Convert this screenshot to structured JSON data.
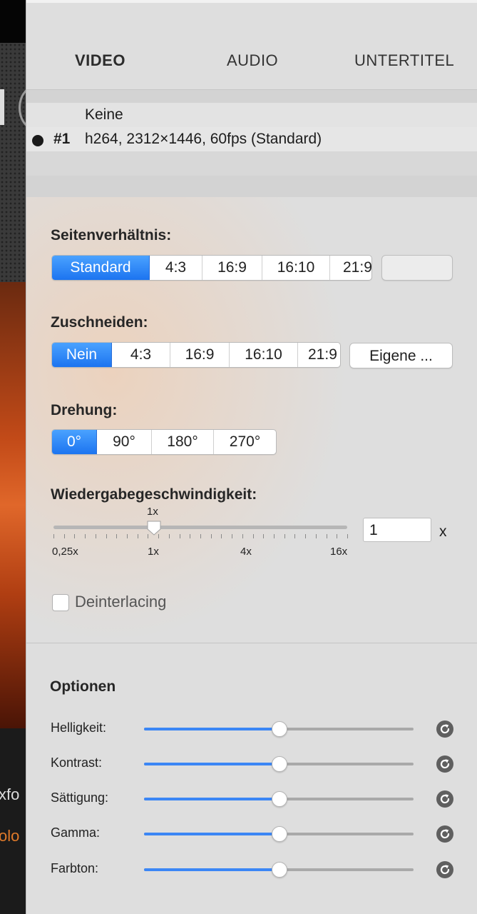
{
  "tabs": [
    "VIDEO",
    "AUDIO",
    "UNTERTITEL"
  ],
  "tracks": [
    {
      "num": "",
      "label": "Keine",
      "selected": false
    },
    {
      "num": "#1",
      "label": "h264, 2312×1446, 60fps (Standard)",
      "selected": true
    }
  ],
  "aspect": {
    "label": "Seitenverhältnis:",
    "options": [
      "Standard",
      "4:3",
      "16:9",
      "16:10",
      "21:9"
    ],
    "selected": "Standard",
    "custom_value": ""
  },
  "crop": {
    "label": "Zuschneiden:",
    "options": [
      "Nein",
      "4:3",
      "16:9",
      "16:10",
      "21:9"
    ],
    "selected": "Nein",
    "custom_button": "Eigene ..."
  },
  "rotation": {
    "label": "Drehung:",
    "options": [
      "0°",
      "90°",
      "180°",
      "270°"
    ],
    "selected": "0°"
  },
  "speed": {
    "label": "Wiedergabegeschwindigkeit:",
    "current_label": "1x",
    "tick_labels": [
      "0,25x",
      "1x",
      "4x",
      "16x"
    ],
    "value": "1",
    "unit": "x"
  },
  "deinterlacing": {
    "label": "Deinterlacing",
    "checked": false
  },
  "options": {
    "title": "Optionen",
    "sliders": [
      {
        "label": "Helligkeit:",
        "value": 0.5
      },
      {
        "label": "Kontrast:",
        "value": 0.5
      },
      {
        "label": "Sättigung:",
        "value": 0.5
      },
      {
        "label": "Gamma:",
        "value": 0.5
      },
      {
        "label": "Farbton:",
        "value": 0.5
      }
    ]
  },
  "colors": {
    "accent": "#1c74f0",
    "slider_fill": "#3b86f5"
  }
}
